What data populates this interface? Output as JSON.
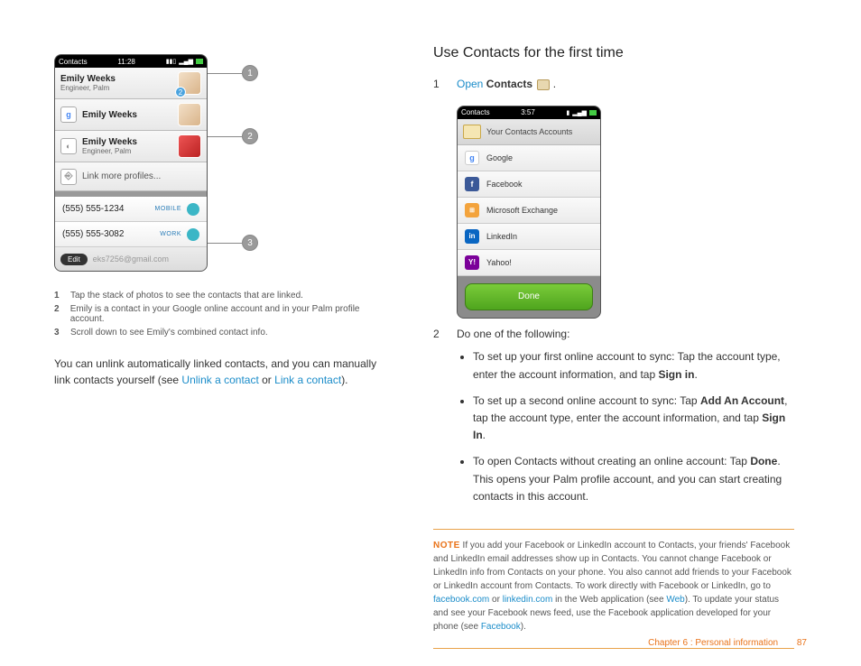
{
  "left": {
    "phone": {
      "appTitle": "Contacts",
      "time": "11:28",
      "primary": {
        "name": "Emily Weeks",
        "subtitle": "Engineer, Palm",
        "badge": "2"
      },
      "linked": [
        {
          "iconType": "g",
          "name": "Emily Weeks"
        },
        {
          "iconType": "gray",
          "name": "Emily Weeks",
          "subtitle": "Engineer, Palm"
        }
      ],
      "linkMore": "Link more profiles...",
      "phones": [
        {
          "num": "(555) 555-1234",
          "tag": "MOBILE"
        },
        {
          "num": "(555) 555-3082",
          "tag": "WORK"
        }
      ],
      "editLabel": "Edit",
      "email": "eks7256@gmail.com"
    },
    "legend": [
      {
        "n": "1",
        "text": "Tap the stack of photos to see the contacts that are linked."
      },
      {
        "n": "2",
        "text": "Emily is a contact in your Google online account and in your Palm profile account."
      },
      {
        "n": "3",
        "text": "Scroll down to see Emily's combined contact info."
      }
    ],
    "paraPrefix": "You can unlink automatically linked contacts, and you can manually link contacts yourself (see ",
    "unlinkLink": "Unlink a contact",
    "paraMid": " or ",
    "linkLink": "Link a contact",
    "paraSuffix": ")."
  },
  "right": {
    "title": "Use Contacts for the first time",
    "step1": {
      "num": "1",
      "open": "Open",
      "contacts": "Contacts",
      "period": " ."
    },
    "accountsPhone": {
      "appTitle": "Contacts",
      "time": "3:57",
      "header": "Your Contacts Accounts",
      "accounts": [
        "Google",
        "Facebook",
        "Microsoft Exchange",
        "LinkedIn",
        "Yahoo!"
      ],
      "doneLabel": "Done"
    },
    "step2": {
      "num": "2",
      "intro": "Do one of the following:"
    },
    "bullets": [
      {
        "pre": "To set up your first online account to sync: Tap the account type, enter the account information, and tap ",
        "b1": "Sign in",
        "post1": "."
      },
      {
        "pre": "To set up a second online account to sync: Tap ",
        "b1": "Add An Account",
        "mid": ", tap the account type, enter the account information, and tap ",
        "b2": "Sign In",
        "post": "."
      },
      {
        "pre": "To open Contacts without creating an online account: Tap ",
        "b1": "Done",
        "post": ". This opens your Palm profile account, and you can start creating contacts in this account."
      }
    ],
    "note": {
      "label": "NOTE",
      "t1": " If you add your Facebook or LinkedIn account to Contacts, your friends' Facebook and LinkedIn email addresses show up in Contacts. You cannot change Facebook or LinkedIn info from Contacts on your phone. You also cannot add friends to your Facebook or LinkedIn account from Contacts. To work directly with Facebook or LinkedIn, go to ",
      "fb": "facebook.com",
      "t2": " or ",
      "li": "linkedin.com",
      "t3": " in the Web application (see ",
      "web": "Web",
      "t4": "). To update your status and see your Facebook news feed, use the Facebook application developed for your phone (see ",
      "fbApp": "Facebook",
      "t5": ")."
    }
  },
  "footer": {
    "chapter": "Chapter 6 : Personal information",
    "page": "87"
  }
}
